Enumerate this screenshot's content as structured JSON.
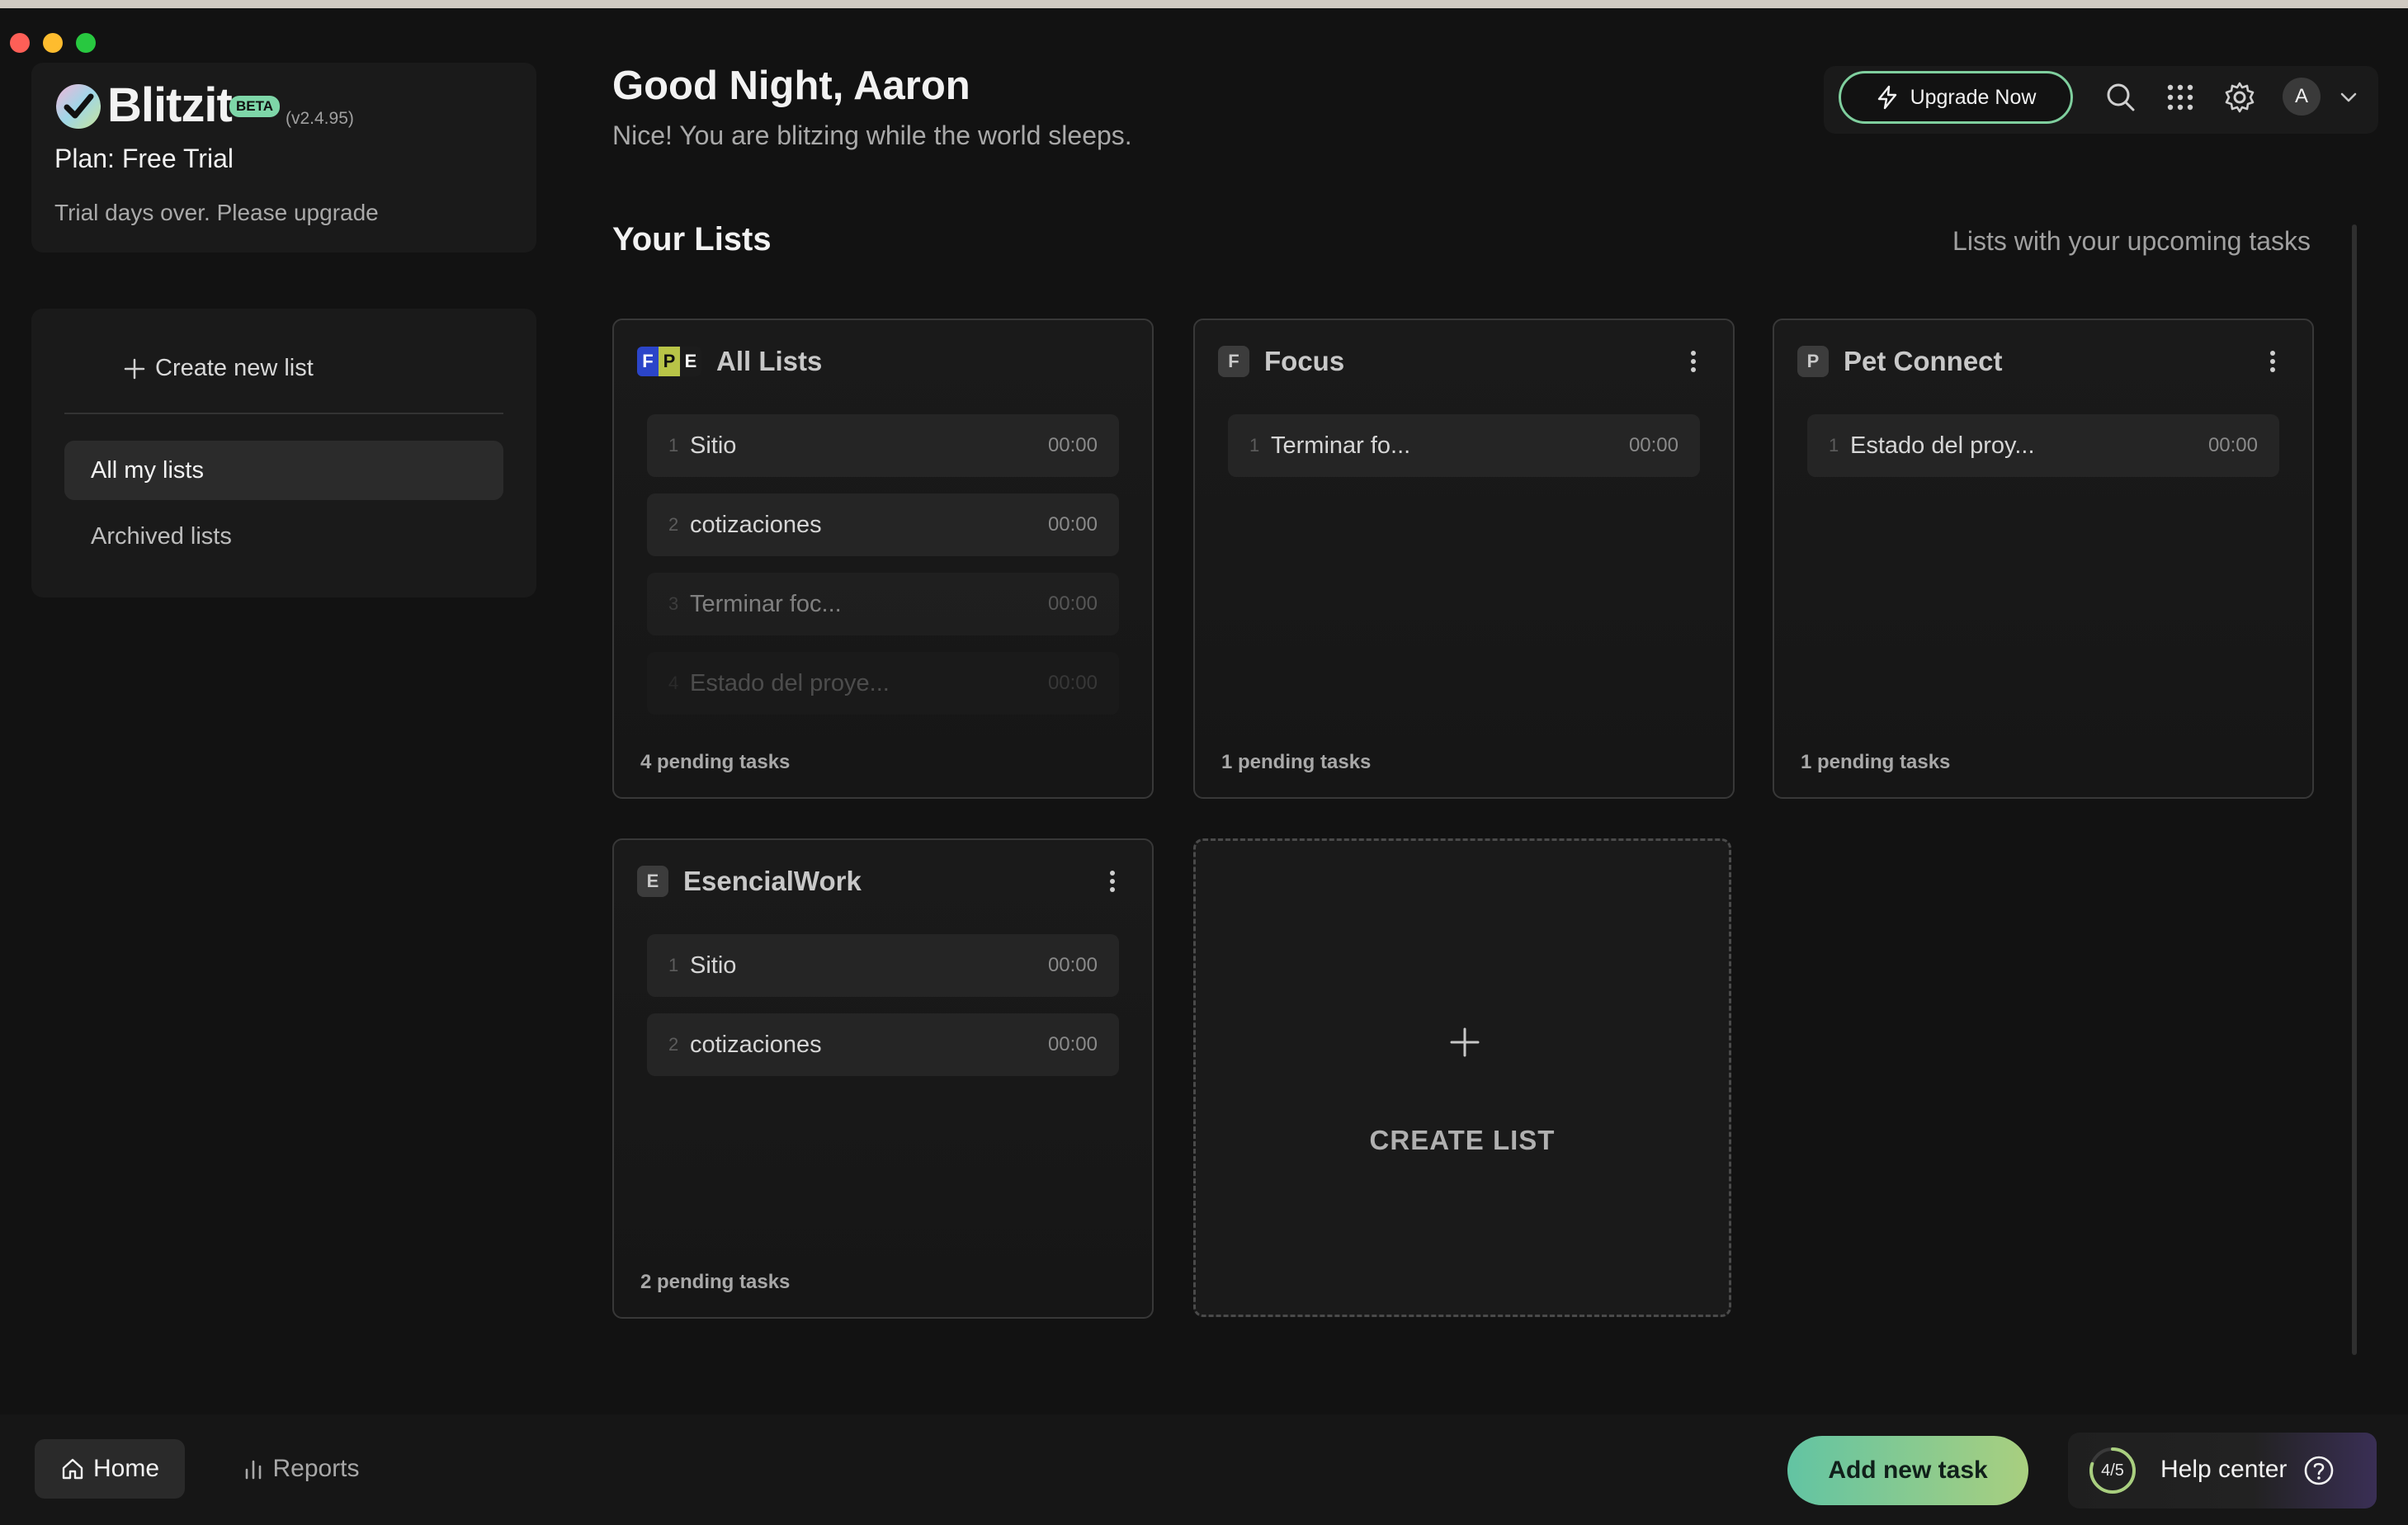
{
  "window": {
    "traffic_lights": [
      "close",
      "minimize",
      "zoom"
    ]
  },
  "brand": {
    "name": "Blitzit",
    "beta": "BETA",
    "version": "(v2.4.95)",
    "plan": "Plan: Free Trial",
    "trial_message": "Trial days over. Please upgrade"
  },
  "sidebar": {
    "create_label": "Create new list",
    "items": [
      {
        "label": "All my lists",
        "active": true
      },
      {
        "label": "Archived lists",
        "active": false
      }
    ]
  },
  "header": {
    "greeting": "Good Night, Aaron",
    "subtitle": "Nice! You are blitzing while the world sleeps.",
    "upgrade_label": "Upgrade Now",
    "avatar_initial": "A"
  },
  "section": {
    "title": "Your Lists",
    "hint": "Lists with your upcoming tasks"
  },
  "lists": [
    {
      "title": "All Lists",
      "badge_letters": [
        "F",
        "P",
        "E"
      ],
      "tasks": [
        {
          "num": "1",
          "name": "Sitio",
          "time": "00:00"
        },
        {
          "num": "2",
          "name": "cotizaciones",
          "time": "00:00"
        },
        {
          "num": "3",
          "name": "Terminar foc...",
          "time": "00:00"
        },
        {
          "num": "4",
          "name": "Estado del proye...",
          "time": "00:00"
        }
      ],
      "pending": "4 pending tasks"
    },
    {
      "title": "Focus",
      "badge": "F",
      "tasks": [
        {
          "num": "1",
          "name": "Terminar fo...",
          "time": "00:00"
        }
      ],
      "pending": "1 pending tasks"
    },
    {
      "title": "Pet Connect",
      "badge": "P",
      "tasks": [
        {
          "num": "1",
          "name": "Estado del proy...",
          "time": "00:00"
        }
      ],
      "pending": "1 pending tasks"
    },
    {
      "title": "EsencialWork",
      "badge": "E",
      "tasks": [
        {
          "num": "1",
          "name": "Sitio",
          "time": "00:00"
        },
        {
          "num": "2",
          "name": "cotizaciones",
          "time": "00:00"
        }
      ],
      "pending": "2 pending tasks"
    }
  ],
  "create_list_label": "CREATE LIST",
  "bottom": {
    "home_label": "Home",
    "reports_label": "Reports",
    "add_task_label": "Add new task",
    "help_label": "Help center",
    "help_progress": "4/5"
  },
  "colors": {
    "accent_green": "#7fcf9e",
    "gradient_start": "#62c4a3",
    "gradient_end": "#a9cf7f",
    "background": "#121212"
  },
  "icons": [
    "logo-icon",
    "bolt-icon",
    "search-icon",
    "apps-grid-icon",
    "gear-icon",
    "chevron-down-icon",
    "kebab-menu-icon",
    "plus-icon",
    "home-icon",
    "bar-chart-icon",
    "help-circle-icon"
  ]
}
